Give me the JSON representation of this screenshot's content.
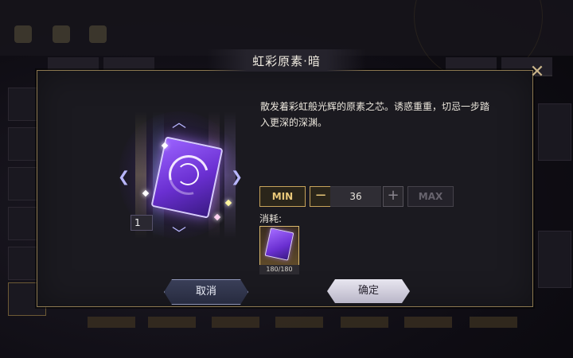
{
  "dialog": {
    "title": "虹彩原素·暗",
    "description": "散发着彩虹般光辉的原素之芯。诱惑重重，切忌一步踏入更深的深渊。",
    "owned_count": "1"
  },
  "quantity": {
    "min_label": "MIN",
    "max_label": "MAX",
    "minus_symbol": "−",
    "plus_symbol": "+",
    "value": "36"
  },
  "consume": {
    "label": "消耗:",
    "material_count": "180/180"
  },
  "buttons": {
    "cancel_label": "取消",
    "confirm_label": "确定"
  },
  "icons": {
    "close": "close-icon",
    "prev": "chevron-left-icon",
    "next": "chevron-right-icon",
    "up": "chevron-up-icon",
    "down": "chevron-down-icon"
  },
  "colors": {
    "accent_gold": "#c7a35a",
    "dialog_bg": "#1b1a20",
    "item_purple": "#6a2fd1"
  }
}
